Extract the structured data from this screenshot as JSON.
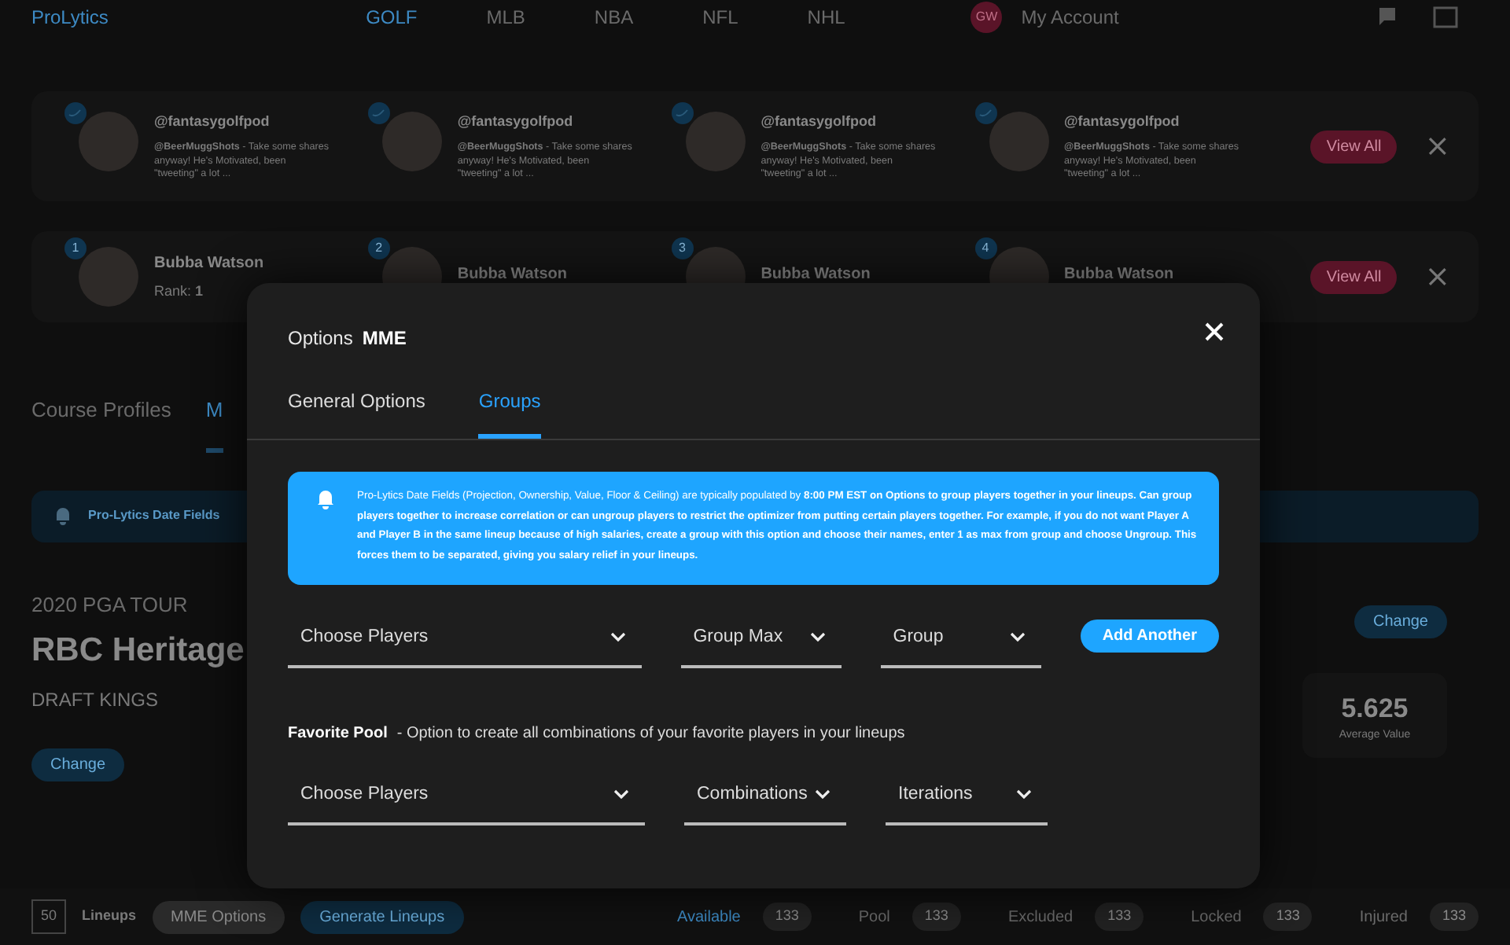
{
  "navbar": {
    "logo": "ProLytics",
    "links": [
      {
        "label": "GOLF",
        "selected": true
      },
      {
        "label": "MLB",
        "selected": false
      },
      {
        "label": "NBA",
        "selected": false
      },
      {
        "label": "NFL",
        "selected": false
      },
      {
        "label": "NHL",
        "selected": false
      }
    ],
    "avatar": "GW",
    "account": "My Account"
  },
  "tweets_panel": {
    "items": [
      {
        "handle": "@fantasygolfpod",
        "text": "**@BeerMuggShots** - Take some shares anyway! He's Motivated, been \"tweeting\" a lot ..."
      },
      {
        "handle": "@fantasygolfpod",
        "text": "**@BeerMuggShots** - Take some shares anyway! He's Motivated, been \"tweeting\" a lot ..."
      },
      {
        "handle": "@fantasygolfpod",
        "text": "**@BeerMuggShots** - Take some shares anyway! He's Motivated, been \"tweeting\" a lot ..."
      },
      {
        "handle": "@fantasygolfpod",
        "text": "**@BeerMuggShots** - Take some shares anyway! He's Motivated, been \"tweeting\" a lot ..."
      }
    ],
    "button": "View All"
  },
  "players_panel": {
    "items": [
      {
        "badge": "1",
        "name": "Bubba Watson",
        "rank": "Rank: **1**"
      },
      {
        "badge": "2",
        "name": "Bubba Watson"
      },
      {
        "badge": "3",
        "name": "Bubba Watson"
      },
      {
        "badge": "4",
        "name": "Bubba Watson"
      }
    ],
    "button": "View All"
  },
  "page_tabs": [
    {
      "label": "Course Profiles",
      "selected": false
    },
    {
      "label": "M",
      "selected": true
    }
  ],
  "page_alert": {
    "text": "Pro-Lytics Date Fields"
  },
  "event": {
    "season": "2020 PGA TOUR",
    "name": "RBC Heritage",
    "site": "DRAFT KINGS",
    "button": "Change"
  },
  "summary": {
    "button": "Change",
    "value": "5.625",
    "label": "Average Value"
  },
  "bottom_bar": {
    "count": "50",
    "count_label": "Lineups",
    "buttons": [
      "MME Options",
      "Generate Lineups"
    ],
    "filters": [
      {
        "label": "Available",
        "count": "133",
        "selected": true
      },
      {
        "label": "Pool",
        "count": "133",
        "selected": false
      },
      {
        "label": "Excluded",
        "count": "133",
        "selected": false
      },
      {
        "label": "Locked",
        "count": "133",
        "selected": false
      },
      {
        "label": "Injured",
        "count": "133",
        "selected": false
      }
    ]
  },
  "modal": {
    "title": "Options",
    "title_strong": "MME",
    "tabs": [
      {
        "label": "General Options",
        "selected": false
      },
      {
        "label": "Groups",
        "selected": true
      }
    ],
    "alert": "Pro-Lytics Date Fields (Projection, Ownership, Value, Floor & Ceiling) are typically populated by **8:00 PM EST on Options to group players together in your lineups. Can group players together to increase correlation or can ungroup players to restrict the optimizer from putting certain players together. For example, if you do not want Player A and Player B in the same lineup because of high salaries, create a group with this option and choose their names, enter 1 as max from group and choose Ungroup. This forces them to be separated, giving you salary relief in your lineups.**",
    "group_row": {
      "selects": [
        "Choose Players",
        "Group Max",
        "Group"
      ],
      "button": "Add Another"
    },
    "favorite": {
      "label": "Favorite Pool",
      "description": "- Option to create all combinations of your favorite players in your lineups"
    },
    "favorite_row": {
      "selects": [
        "Choose Players",
        "Combinations",
        "Iterations"
      ]
    }
  }
}
